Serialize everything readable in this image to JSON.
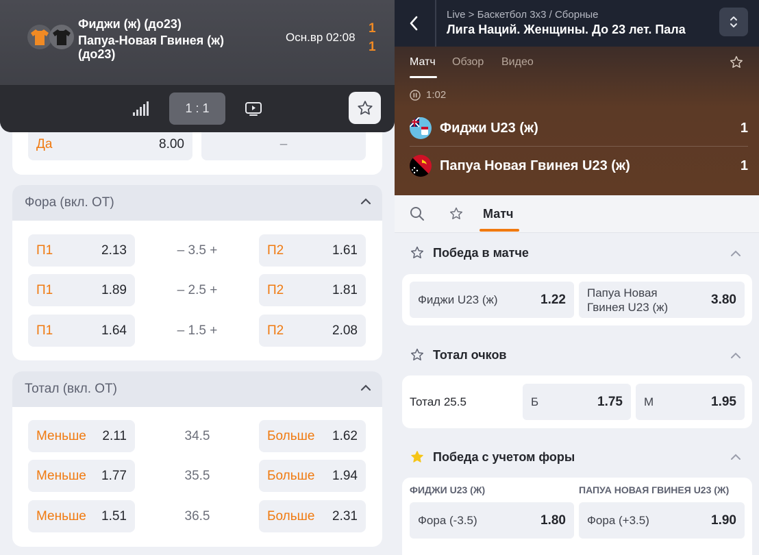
{
  "left": {
    "header": {
      "team1": "Фиджи (ж) (до23)",
      "team2_line1": "Папуа-Новая Гвинея (ж)",
      "team2_line2": "(до23)",
      "time": "Осн.вр  02:08",
      "score1": "1",
      "score2": "1",
      "jersey1_color": "#f08a24",
      "jersey2_color": "#1b1b1b"
    },
    "toolbar": {
      "stats_icon": "signal-bars-icon",
      "score_label": "1 : 1",
      "tv_icon": "tv-icon",
      "fav_icon": "star-icon"
    },
    "yes_row": {
      "label": "Да",
      "value": "8.00",
      "other": "–"
    },
    "handicap": {
      "title": "Фора (вкл. ОТ)",
      "rows": [
        {
          "l1": "П1",
          "v1": "2.13",
          "mid": "– 3.5 +",
          "l2": "П2",
          "v2": "1.61"
        },
        {
          "l1": "П1",
          "v1": "1.89",
          "mid": "– 2.5 +",
          "l2": "П2",
          "v2": "1.81"
        },
        {
          "l1": "П1",
          "v1": "1.64",
          "mid": "– 1.5 +",
          "l2": "П2",
          "v2": "2.08"
        }
      ]
    },
    "total": {
      "title": "Тотал (вкл. ОТ)",
      "rows": [
        {
          "l1": "Меньше",
          "v1": "2.11",
          "mid": "34.5",
          "l2": "Больше",
          "v2": "1.62"
        },
        {
          "l1": "Меньше",
          "v1": "1.77",
          "mid": "35.5",
          "l2": "Больше",
          "v2": "1.94"
        },
        {
          "l1": "Меньше",
          "v1": "1.51",
          "mid": "36.5",
          "l2": "Больше",
          "v2": "2.31"
        }
      ]
    }
  },
  "right": {
    "breadcrumb": "Live > Баскетбол 3x3 / Сборные",
    "league": "Лига Наций. Женщины. До 23 лет. Пала",
    "tabs": [
      "Матч",
      "Обзор",
      "Видео"
    ],
    "clock": "1:02",
    "team1": {
      "name": "Фиджи U23 (ж)",
      "score": "1"
    },
    "team2": {
      "name": "Папуа Новая Гвинея U23 (ж)",
      "score": "1"
    },
    "nav_match": "Матч",
    "win": {
      "title": "Победа в матче",
      "left_label": "Фиджи U23 (ж)",
      "left_value": "1.22",
      "right_label_1": "Папуа Новая",
      "right_label_2": "Гвинея U23 (ж)",
      "right_value": "3.80"
    },
    "total": {
      "title": "Тотал очков",
      "label": "Тотал 25.5",
      "over_label": "Б",
      "over_value": "1.75",
      "under_label": "М",
      "under_value": "1.95"
    },
    "handicap": {
      "title": "Победа с учетом форы",
      "col1": "ФИДЖИ U23 (Ж)",
      "col2": "ПАПУА НОВАЯ ГВИНЕЯ U23 (Ж)",
      "left_label": "Фора (-3.5)",
      "left_value": "1.80",
      "right_label": "Фора (+3.5)",
      "right_value": "1.90"
    },
    "accent": "#f07a10",
    "favorite_color": "#f5c518"
  }
}
